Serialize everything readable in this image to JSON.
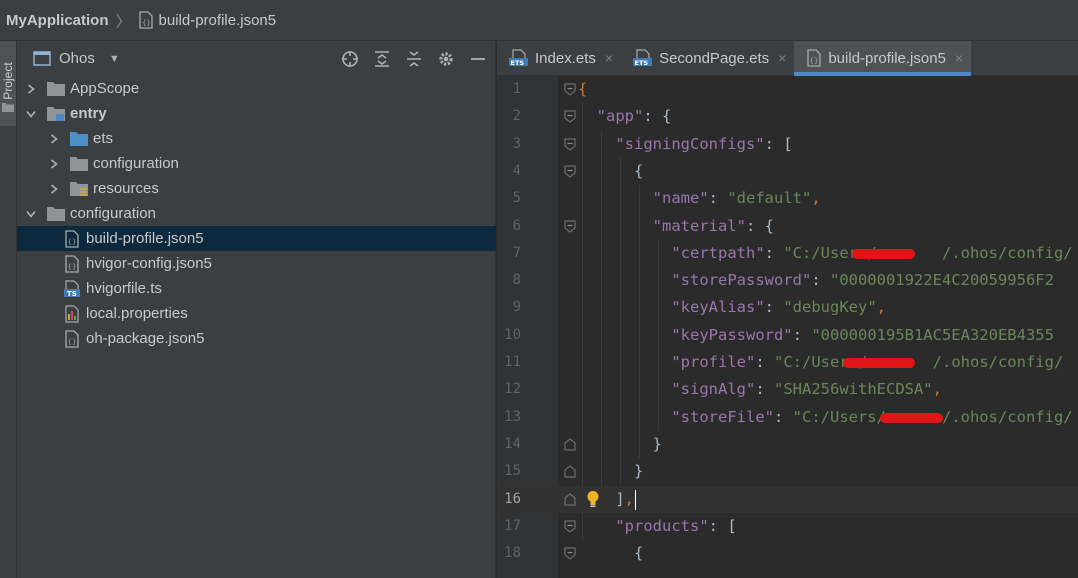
{
  "breadcrumb": {
    "project": "MyApplication",
    "file": "build-profile.json5"
  },
  "stripe": {
    "label": "Project"
  },
  "panel": {
    "view_name": "Ohos",
    "tools": [
      "target-icon",
      "expand-all-icon",
      "collapse-all-icon",
      "gear-icon",
      "minimize-icon"
    ],
    "tree": [
      {
        "label": "AppScope",
        "depth": 0,
        "arrow": "right",
        "icon": "folder-icon",
        "bold": false
      },
      {
        "label": "entry",
        "depth": 0,
        "arrow": "down",
        "icon": "module-folder-icon",
        "bold": true
      },
      {
        "label": "ets",
        "depth": 1,
        "arrow": "right",
        "icon": "source-folder-icon",
        "bold": false
      },
      {
        "label": "configuration",
        "depth": 1,
        "arrow": "right",
        "icon": "folder-icon",
        "bold": false
      },
      {
        "label": "resources",
        "depth": 1,
        "arrow": "right",
        "icon": "resources-folder-icon",
        "bold": false
      },
      {
        "label": "configuration",
        "depth": 0,
        "arrow": "down",
        "icon": "folder-icon",
        "bold": false
      },
      {
        "label": "build-profile.json5",
        "depth": 1,
        "arrow": "",
        "icon": "json-file-icon",
        "bold": false,
        "selected": true
      },
      {
        "label": "hvigor-config.json5",
        "depth": 1,
        "arrow": "",
        "icon": "json-file-icon",
        "bold": false
      },
      {
        "label": "hvigorfile.ts",
        "depth": 1,
        "arrow": "",
        "icon": "ts-file-icon",
        "bold": false
      },
      {
        "label": "local.properties",
        "depth": 1,
        "arrow": "",
        "icon": "properties-file-icon",
        "bold": false
      },
      {
        "label": "oh-package.json5",
        "depth": 1,
        "arrow": "",
        "icon": "json-file-icon",
        "bold": false
      }
    ]
  },
  "tabs": [
    {
      "label": "Index.ets",
      "icon": "ets-file-icon",
      "active": false,
      "close": "×"
    },
    {
      "label": "SecondPage.ets",
      "icon": "ets-file-icon",
      "active": false,
      "close": "×"
    },
    {
      "label": "build-profile.json5",
      "icon": "json-file-icon",
      "active": true,
      "close": "×"
    }
  ],
  "editor": {
    "current_line": 16,
    "lines": [
      {
        "n": "1",
        "indent": 0,
        "tokens": [
          [
            "p",
            "{"
          ]
        ],
        "fold": "open"
      },
      {
        "n": "2",
        "indent": 1,
        "tokens": [
          [
            "k",
            "\"app\""
          ],
          [
            "t",
            ": {"
          ]
        ],
        "fold": "open"
      },
      {
        "n": "3",
        "indent": 2,
        "tokens": [
          [
            "k",
            "\"signingConfigs\""
          ],
          [
            "t",
            ": ["
          ]
        ],
        "fold": "open"
      },
      {
        "n": "4",
        "indent": 3,
        "tokens": [
          [
            "t",
            "{"
          ]
        ],
        "fold": "open"
      },
      {
        "n": "5",
        "indent": 4,
        "tokens": [
          [
            "k",
            "\"name\""
          ],
          [
            "t",
            ": "
          ],
          [
            "s",
            "\"default\""
          ],
          [
            "p",
            ","
          ]
        ],
        "fold": ""
      },
      {
        "n": "6",
        "indent": 4,
        "tokens": [
          [
            "k",
            "\"material\""
          ],
          [
            "t",
            ": {"
          ]
        ],
        "fold": "open"
      },
      {
        "n": "7",
        "indent": 5,
        "tokens": [
          [
            "k",
            "\"certpath\""
          ],
          [
            "t",
            ": "
          ],
          [
            "s",
            "\"C:/Users/"
          ],
          [
            "s",
            "       "
          ],
          [
            "s",
            "/.ohos/config/"
          ]
        ],
        "fold": "",
        "redact": [
          {
            "from": 19,
            "len": 6
          }
        ]
      },
      {
        "n": "8",
        "indent": 5,
        "tokens": [
          [
            "k",
            "\"storePassword\""
          ],
          [
            "t",
            ": "
          ],
          [
            "s",
            "\"0000001922E4C20059956F2"
          ]
        ],
        "fold": ""
      },
      {
        "n": "9",
        "indent": 5,
        "tokens": [
          [
            "k",
            "\"keyAlias\""
          ],
          [
            "t",
            ": "
          ],
          [
            "s",
            "\"debugKey\""
          ],
          [
            "p",
            ","
          ]
        ],
        "fold": ""
      },
      {
        "n": "10",
        "indent": 5,
        "tokens": [
          [
            "k",
            "\"keyPassword\""
          ],
          [
            "t",
            ": "
          ],
          [
            "s",
            "\"000000195B1AC5EA320EB4355"
          ]
        ],
        "fold": ""
      },
      {
        "n": "11",
        "indent": 5,
        "tokens": [
          [
            "k",
            "\"profile\""
          ],
          [
            "t",
            ": "
          ],
          [
            "s",
            "\"C:/Users/"
          ],
          [
            "s",
            "       "
          ],
          [
            "s",
            "/.ohos/config/"
          ]
        ],
        "fold": "",
        "redact": [
          {
            "from": 18,
            "len": 7
          }
        ]
      },
      {
        "n": "12",
        "indent": 5,
        "tokens": [
          [
            "k",
            "\"signAlg\""
          ],
          [
            "t",
            ": "
          ],
          [
            "s",
            "\"SHA256withECDSA\""
          ],
          [
            "p",
            ","
          ]
        ],
        "fold": ""
      },
      {
        "n": "13",
        "indent": 5,
        "tokens": [
          [
            "k",
            "\"storeFile\""
          ],
          [
            "t",
            ": "
          ],
          [
            "s",
            "\"C:/Users/"
          ],
          [
            "s",
            "      "
          ],
          [
            "s",
            "/.ohos/config/"
          ]
        ],
        "fold": "",
        "redact": [
          {
            "from": 22,
            "len": 6
          }
        ]
      },
      {
        "n": "14",
        "indent": 4,
        "tokens": [
          [
            "t",
            "}"
          ]
        ],
        "fold": "close"
      },
      {
        "n": "15",
        "indent": 3,
        "tokens": [
          [
            "t",
            "}"
          ]
        ],
        "fold": "close"
      },
      {
        "n": "16",
        "indent": 2,
        "tokens": [
          [
            "t",
            "]"
          ],
          [
            "p",
            ","
          ]
        ],
        "fold": "close",
        "bulb": true
      },
      {
        "n": "17",
        "indent": 2,
        "tokens": [
          [
            "k",
            "\"products\""
          ],
          [
            "t",
            ": ["
          ]
        ],
        "fold": "open"
      },
      {
        "n": "18",
        "indent": 3,
        "tokens": [
          [
            "t",
            "{"
          ]
        ],
        "fold": "open"
      }
    ]
  }
}
